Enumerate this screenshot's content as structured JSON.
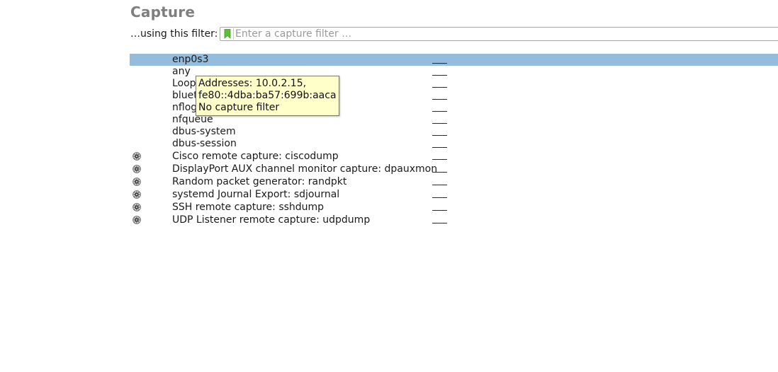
{
  "capture": {
    "title": "Capture",
    "filter_label": "…using this filter:",
    "filter_placeholder": "Enter a capture filter …",
    "filter_value": ""
  },
  "interfaces": [
    {
      "name": "enp0s3",
      "selected": true,
      "extcap": false
    },
    {
      "name": "any",
      "selected": false,
      "extcap": false
    },
    {
      "name": "Loopback: lo",
      "selected": false,
      "extcap": false
    },
    {
      "name": "bluetooth-monitor",
      "selected": false,
      "extcap": false
    },
    {
      "name": "nflog",
      "selected": false,
      "extcap": false
    },
    {
      "name": "nfqueue",
      "selected": false,
      "extcap": false
    },
    {
      "name": "dbus-system",
      "selected": false,
      "extcap": false
    },
    {
      "name": "dbus-session",
      "selected": false,
      "extcap": false
    },
    {
      "name": "Cisco remote capture: ciscodump",
      "selected": false,
      "extcap": true
    },
    {
      "name": "DisplayPort AUX channel monitor capture: dpauxmon",
      "selected": false,
      "extcap": true
    },
    {
      "name": "Random packet generator: randpkt",
      "selected": false,
      "extcap": true
    },
    {
      "name": "systemd Journal Export: sdjournal",
      "selected": false,
      "extcap": true
    },
    {
      "name": "SSH remote capture: sshdump",
      "selected": false,
      "extcap": true
    },
    {
      "name": "UDP Listener remote capture: udpdump",
      "selected": false,
      "extcap": true
    }
  ],
  "tooltip": {
    "line1": "Addresses: 10.0.2.15,",
    "line2": "fe80::4dba:ba57:699b:aaca",
    "line3": "No capture filter"
  },
  "colors": {
    "selection": "#94bcdc",
    "title": "#7f7f7f",
    "tooltip_bg": "#ffffca",
    "bookmark": "#5bbf3a"
  },
  "icons": {
    "bookmark": "bookmark-icon",
    "extcap_options": "gear-icon"
  }
}
